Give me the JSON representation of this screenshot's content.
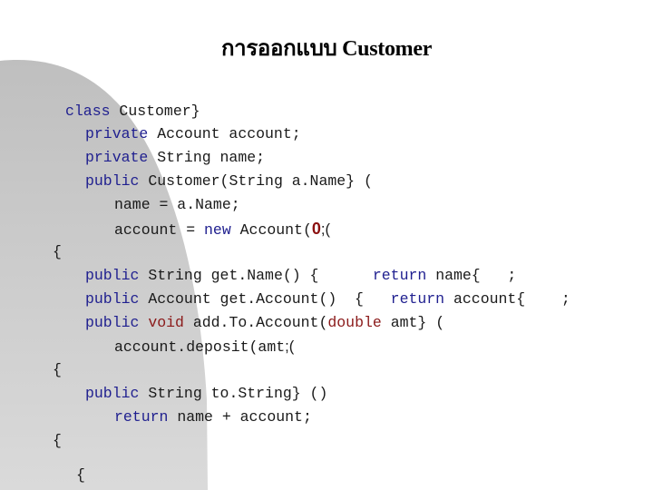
{
  "slide": {
    "title": "การออกแบบ Customer",
    "colors": {
      "keyword": "#1f1f8f",
      "type_keyword": "#8b1a1a",
      "literal": "#8b1010",
      "text": "#1a1a1a",
      "background_shape_top": "#c0c0c0",
      "background_shape_bottom": "#d9d9d9"
    },
    "code_lines": [
      {
        "tokens": [
          {
            "t": "class",
            "k": "kw"
          },
          {
            "t": " Customer}",
            "k": ""
          }
        ]
      },
      {
        "tokens": [
          {
            "t": "private",
            "k": "kw"
          },
          {
            "t": " Account account;",
            "k": ""
          }
        ]
      },
      {
        "tokens": [
          {
            "t": "private",
            "k": "kw"
          },
          {
            "t": " String name;",
            "k": ""
          }
        ]
      },
      {
        "tokens": [
          {
            "t": "public",
            "k": "kw"
          },
          {
            "t": " Customer(String a.Name} (",
            "k": ""
          }
        ]
      },
      {
        "tokens": [
          {
            "t": "name = a.Name;",
            "k": ""
          }
        ]
      },
      {
        "tokens": [
          {
            "t": "account = ",
            "k": ""
          },
          {
            "t": "new",
            "k": "kw"
          },
          {
            "t": " Account(",
            "k": ""
          },
          {
            "t": "0",
            "k": "num"
          },
          {
            "t": ";(",
            "k": "punct"
          }
        ]
      },
      {
        "tokens": [
          {
            "t": "{",
            "k": ""
          }
        ]
      },
      {
        "tokens": [
          {
            "t": "public",
            "k": "kw"
          },
          {
            "t": " String get.Name() {      ",
            "k": ""
          },
          {
            "t": "return",
            "k": "kw"
          },
          {
            "t": " name{   ;",
            "k": ""
          }
        ]
      },
      {
        "tokens": [
          {
            "t": "public",
            "k": "kw"
          },
          {
            "t": " Account get.Account()  {   ",
            "k": ""
          },
          {
            "t": "return",
            "k": "kw"
          },
          {
            "t": " account{    ;",
            "k": ""
          }
        ]
      },
      {
        "tokens": [
          {
            "t": "public",
            "k": "kw"
          },
          {
            "t": " ",
            "k": ""
          },
          {
            "t": "void",
            "k": "kw2"
          },
          {
            "t": " add.To.Account(",
            "k": ""
          },
          {
            "t": "double",
            "k": "kw2"
          },
          {
            "t": " amt} (",
            "k": ""
          }
        ]
      },
      {
        "tokens": [
          {
            "t": "account.deposit(amt",
            "k": ""
          },
          {
            "t": ";(",
            "k": "punct"
          }
        ]
      },
      {
        "tokens": [
          {
            "t": "{",
            "k": ""
          }
        ]
      },
      {
        "tokens": [
          {
            "t": "public",
            "k": "kw"
          },
          {
            "t": " String to.String} ()",
            "k": ""
          }
        ]
      },
      {
        "tokens": [
          {
            "t": "return",
            "k": "kw"
          },
          {
            "t": " name + account;",
            "k": ""
          }
        ]
      },
      {
        "tokens": [
          {
            "t": "{",
            "k": ""
          }
        ]
      },
      {
        "tokens": [
          {
            "t": "{",
            "k": ""
          }
        ]
      }
    ]
  }
}
